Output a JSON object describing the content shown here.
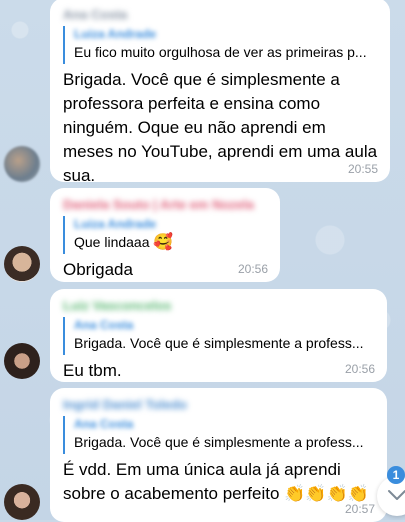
{
  "messages": [
    {
      "sender": "Ana Costa",
      "reply": {
        "name": "Luiza Andrade",
        "text": "Eu fico muito orgulhosa de ver as primeiras p..."
      },
      "text": "Brigada. Você que é simplesmente a professora perfeita e ensina como ninguém. Oque eu não aprendi em meses no YouTube, aprendi em uma aula sua.",
      "time": "20:55"
    },
    {
      "sender": "Daniela Souto | Arte em Nozela",
      "reply": {
        "name": "Luiza Andrade",
        "text": "Que lindaaa",
        "emoji": "🥰"
      },
      "text": "Obrigada",
      "time": "20:56"
    },
    {
      "sender": "Luiz Vasconcelos",
      "reply": {
        "name": "Ana Costa",
        "text": "Brigada. Você que é simplesmente a profess..."
      },
      "text": "Eu tbm.",
      "time": "20:56"
    },
    {
      "sender": "Ingrid Daniel Toledo",
      "reply": {
        "name": "Ana Costa",
        "text": "Brigada. Você que é simplesmente a profess..."
      },
      "text": "É vdd. Em uma única aula já aprendi sobre o acabemento perfeito",
      "emoji": "👏👏👏👏",
      "time": "20:57"
    }
  ],
  "scroll_down": {
    "unread_count": "1",
    "icon": "chevron-down-icon"
  }
}
